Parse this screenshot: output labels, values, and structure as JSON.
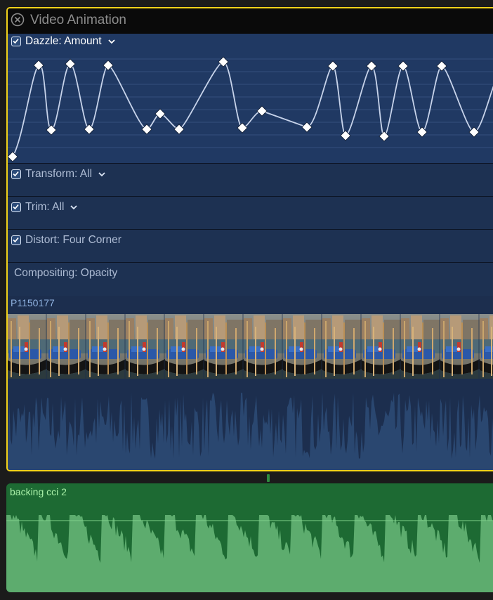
{
  "clip_title": "Video Animation",
  "lanes": [
    {
      "label": "Dazzle: Amount",
      "checked": true,
      "has_menu": true
    },
    {
      "label": "Transform: All",
      "checked": true,
      "has_menu": true
    },
    {
      "label": "Trim: All",
      "checked": true,
      "has_menu": true
    },
    {
      "label": "Distort: Four Corner",
      "checked": true,
      "has_menu": false
    },
    {
      "label": "Compositing: Opacity",
      "checked": false,
      "has_menu": false
    }
  ],
  "keyframes": {
    "count": 21
  },
  "video_clip": {
    "name": "P1150177"
  },
  "audio_clip": {
    "name": "backing cci 2"
  },
  "colors": {
    "selection_border": "#f2d21a",
    "animation_lane": "#203963",
    "video_clip": "#1c2e4e",
    "audio_clip": "#1d6a33",
    "audio_wave": "#5dac6e"
  },
  "icons": [
    "close-icon",
    "checkbox-icon",
    "chevron-down-icon",
    "keyframe-icon"
  ]
}
